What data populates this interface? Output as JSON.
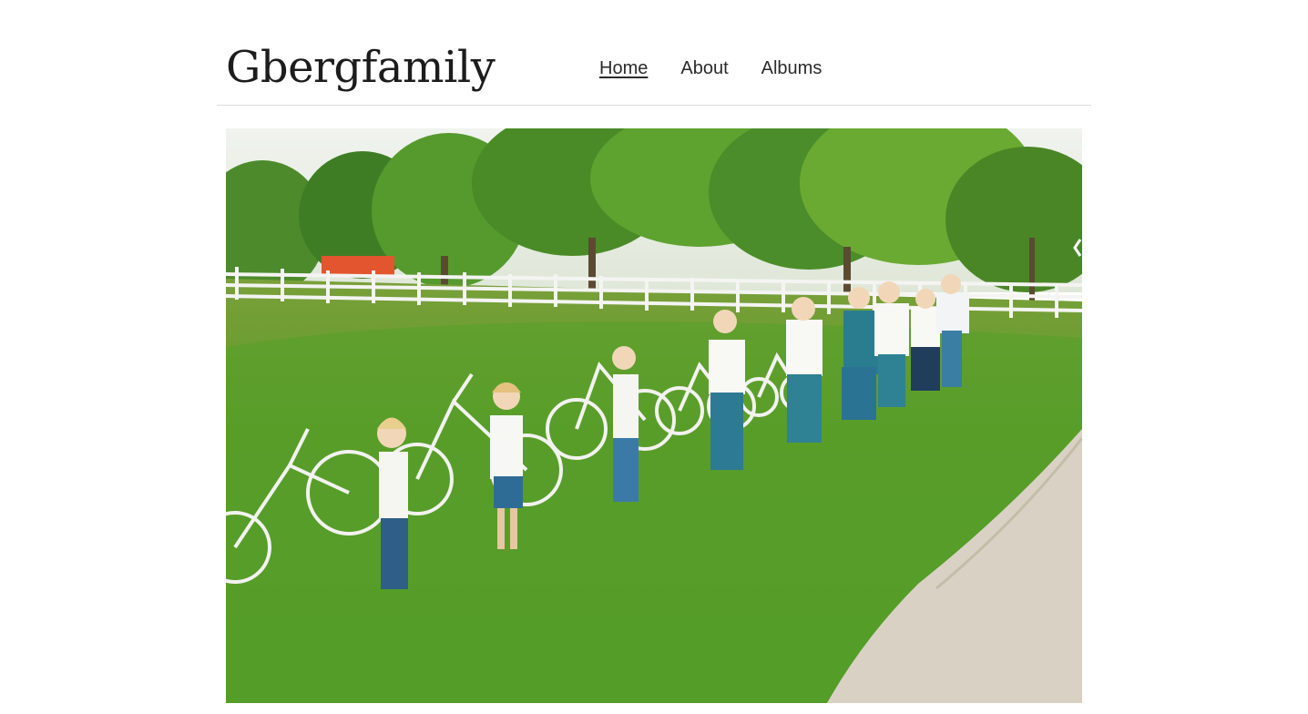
{
  "site": {
    "title": "Gbergfamily"
  },
  "nav": {
    "items": [
      {
        "label": "Home",
        "active": true
      },
      {
        "label": "About",
        "active": false
      },
      {
        "label": "Albums",
        "active": false
      }
    ]
  },
  "hero": {
    "icon": "chevron-left-icon",
    "colors": {
      "sky": "#e9efe6",
      "trees": "#4f8f2a",
      "grass": "#5a9e2c",
      "path": "#d9d2c4",
      "fence": "#f4f4f2",
      "barn": "#e2552f"
    }
  }
}
